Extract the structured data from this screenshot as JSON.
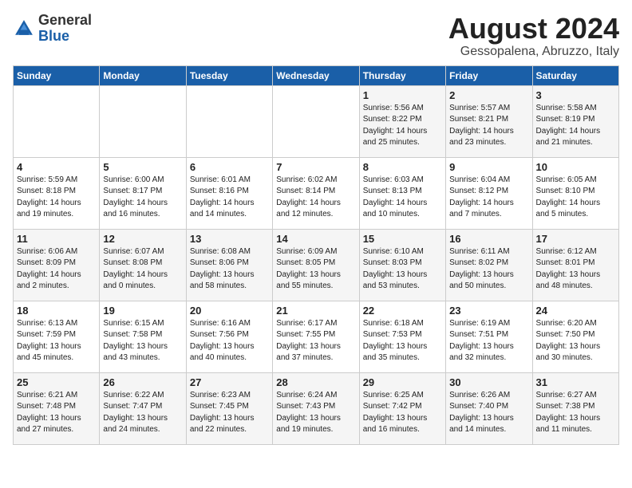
{
  "header": {
    "logo_general": "General",
    "logo_blue": "Blue",
    "month_year": "August 2024",
    "location": "Gessopalena, Abruzzo, Italy"
  },
  "weekdays": [
    "Sunday",
    "Monday",
    "Tuesday",
    "Wednesday",
    "Thursday",
    "Friday",
    "Saturday"
  ],
  "weeks": [
    [
      {
        "day": "",
        "info": ""
      },
      {
        "day": "",
        "info": ""
      },
      {
        "day": "",
        "info": ""
      },
      {
        "day": "",
        "info": ""
      },
      {
        "day": "1",
        "info": "Sunrise: 5:56 AM\nSunset: 8:22 PM\nDaylight: 14 hours\nand 25 minutes."
      },
      {
        "day": "2",
        "info": "Sunrise: 5:57 AM\nSunset: 8:21 PM\nDaylight: 14 hours\nand 23 minutes."
      },
      {
        "day": "3",
        "info": "Sunrise: 5:58 AM\nSunset: 8:19 PM\nDaylight: 14 hours\nand 21 minutes."
      }
    ],
    [
      {
        "day": "4",
        "info": "Sunrise: 5:59 AM\nSunset: 8:18 PM\nDaylight: 14 hours\nand 19 minutes."
      },
      {
        "day": "5",
        "info": "Sunrise: 6:00 AM\nSunset: 8:17 PM\nDaylight: 14 hours\nand 16 minutes."
      },
      {
        "day": "6",
        "info": "Sunrise: 6:01 AM\nSunset: 8:16 PM\nDaylight: 14 hours\nand 14 minutes."
      },
      {
        "day": "7",
        "info": "Sunrise: 6:02 AM\nSunset: 8:14 PM\nDaylight: 14 hours\nand 12 minutes."
      },
      {
        "day": "8",
        "info": "Sunrise: 6:03 AM\nSunset: 8:13 PM\nDaylight: 14 hours\nand 10 minutes."
      },
      {
        "day": "9",
        "info": "Sunrise: 6:04 AM\nSunset: 8:12 PM\nDaylight: 14 hours\nand 7 minutes."
      },
      {
        "day": "10",
        "info": "Sunrise: 6:05 AM\nSunset: 8:10 PM\nDaylight: 14 hours\nand 5 minutes."
      }
    ],
    [
      {
        "day": "11",
        "info": "Sunrise: 6:06 AM\nSunset: 8:09 PM\nDaylight: 14 hours\nand 2 minutes."
      },
      {
        "day": "12",
        "info": "Sunrise: 6:07 AM\nSunset: 8:08 PM\nDaylight: 14 hours\nand 0 minutes."
      },
      {
        "day": "13",
        "info": "Sunrise: 6:08 AM\nSunset: 8:06 PM\nDaylight: 13 hours\nand 58 minutes."
      },
      {
        "day": "14",
        "info": "Sunrise: 6:09 AM\nSunset: 8:05 PM\nDaylight: 13 hours\nand 55 minutes."
      },
      {
        "day": "15",
        "info": "Sunrise: 6:10 AM\nSunset: 8:03 PM\nDaylight: 13 hours\nand 53 minutes."
      },
      {
        "day": "16",
        "info": "Sunrise: 6:11 AM\nSunset: 8:02 PM\nDaylight: 13 hours\nand 50 minutes."
      },
      {
        "day": "17",
        "info": "Sunrise: 6:12 AM\nSunset: 8:01 PM\nDaylight: 13 hours\nand 48 minutes."
      }
    ],
    [
      {
        "day": "18",
        "info": "Sunrise: 6:13 AM\nSunset: 7:59 PM\nDaylight: 13 hours\nand 45 minutes."
      },
      {
        "day": "19",
        "info": "Sunrise: 6:15 AM\nSunset: 7:58 PM\nDaylight: 13 hours\nand 43 minutes."
      },
      {
        "day": "20",
        "info": "Sunrise: 6:16 AM\nSunset: 7:56 PM\nDaylight: 13 hours\nand 40 minutes."
      },
      {
        "day": "21",
        "info": "Sunrise: 6:17 AM\nSunset: 7:55 PM\nDaylight: 13 hours\nand 37 minutes."
      },
      {
        "day": "22",
        "info": "Sunrise: 6:18 AM\nSunset: 7:53 PM\nDaylight: 13 hours\nand 35 minutes."
      },
      {
        "day": "23",
        "info": "Sunrise: 6:19 AM\nSunset: 7:51 PM\nDaylight: 13 hours\nand 32 minutes."
      },
      {
        "day": "24",
        "info": "Sunrise: 6:20 AM\nSunset: 7:50 PM\nDaylight: 13 hours\nand 30 minutes."
      }
    ],
    [
      {
        "day": "25",
        "info": "Sunrise: 6:21 AM\nSunset: 7:48 PM\nDaylight: 13 hours\nand 27 minutes."
      },
      {
        "day": "26",
        "info": "Sunrise: 6:22 AM\nSunset: 7:47 PM\nDaylight: 13 hours\nand 24 minutes."
      },
      {
        "day": "27",
        "info": "Sunrise: 6:23 AM\nSunset: 7:45 PM\nDaylight: 13 hours\nand 22 minutes."
      },
      {
        "day": "28",
        "info": "Sunrise: 6:24 AM\nSunset: 7:43 PM\nDaylight: 13 hours\nand 19 minutes."
      },
      {
        "day": "29",
        "info": "Sunrise: 6:25 AM\nSunset: 7:42 PM\nDaylight: 13 hours\nand 16 minutes."
      },
      {
        "day": "30",
        "info": "Sunrise: 6:26 AM\nSunset: 7:40 PM\nDaylight: 13 hours\nand 14 minutes."
      },
      {
        "day": "31",
        "info": "Sunrise: 6:27 AM\nSunset: 7:38 PM\nDaylight: 13 hours\nand 11 minutes."
      }
    ]
  ]
}
